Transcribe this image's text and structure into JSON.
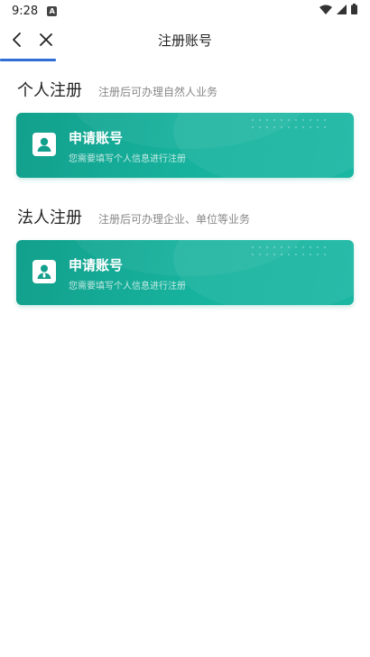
{
  "status_bar": {
    "time": "9:28",
    "app_icon_letter": "A",
    "icons": [
      "wifi-icon",
      "signal-icon",
      "battery-icon"
    ]
  },
  "nav": {
    "title": "注册账号",
    "back_icon": "chevron-left-icon",
    "close_icon": "close-icon"
  },
  "colors": {
    "accent": "#2f6fd6",
    "card_start": "#12a08c",
    "card_end": "#1ab7a3"
  },
  "sections": [
    {
      "title": "个人注册",
      "desc": "注册后可办理自然人业务",
      "card": {
        "title": "申请账号",
        "subtitle": "您需要填写个人信息进行注册",
        "icon": "person-icon"
      }
    },
    {
      "title": "法人注册",
      "desc": "注册后可办理企业、单位等业务",
      "card": {
        "title": "申请账号",
        "subtitle": "您需要填写个人信息进行注册",
        "icon": "business-person-icon"
      }
    }
  ]
}
